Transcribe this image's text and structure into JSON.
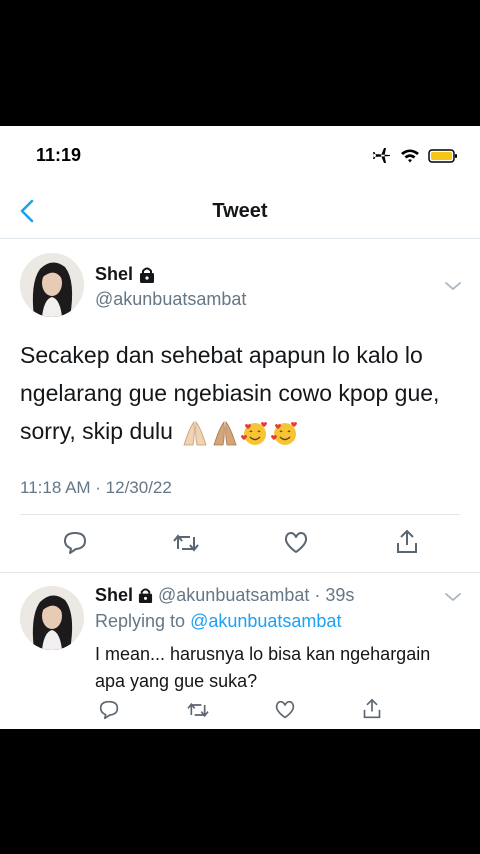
{
  "status_bar": {
    "time": "11:19"
  },
  "nav": {
    "title": "Tweet"
  },
  "main_tweet": {
    "name": "Shel",
    "handle": "@akunbuatsambat",
    "text": "Secakep dan sehebat apapun lo kalo lo ngelarang gue ngebiasin cowo kpop gue, sorry, skip dulu",
    "emojis": [
      "folded-hands-light",
      "folded-hands-medium",
      "smiling-face-with-hearts",
      "smiling-face-with-hearts"
    ],
    "timestamp": "11:18 AM · 12/30/22"
  },
  "reply": {
    "name": "Shel",
    "handle_time": "@akunbuatsambat · 39s",
    "replying_prefix": "Replying to",
    "replying_to": "@akunbuatsambat",
    "text_line1": "I mean... harusnya lo bisa kan ngehargain",
    "text_line2": "apa yang gue suka?"
  },
  "colors": {
    "accent": "#1da1f2",
    "text": "#14171a",
    "muted": "#657786",
    "divider": "#e1e8ed"
  }
}
